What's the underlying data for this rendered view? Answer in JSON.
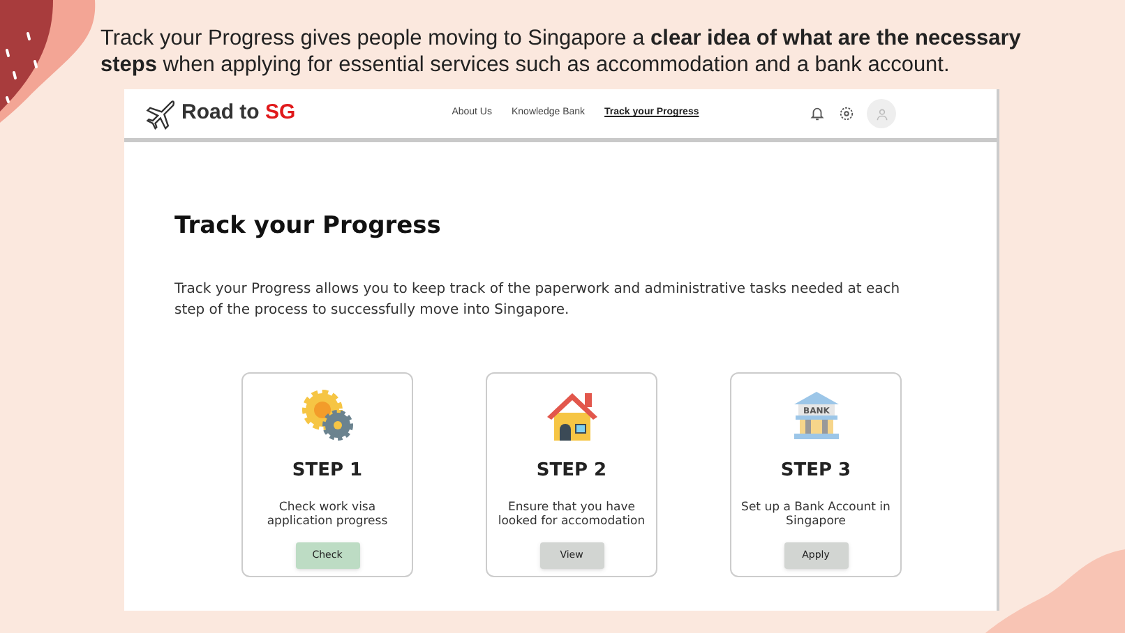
{
  "caption": "Track your Progress gives people moving to Singapore a **clear idea of what are the necessary steps** when applying for essential services such as accommodation and a bank account.",
  "header": {
    "logo_text": "Road to ",
    "logo_accent": "SG",
    "nav": [
      {
        "label": "About Us",
        "selected": false
      },
      {
        "label": "Knowledge Bank",
        "selected": false
      },
      {
        "label": "Track your Progress",
        "selected": true
      }
    ]
  },
  "page": {
    "title": "Track your Progress",
    "description": "Track your Progress allows you to keep track of the paperwork and administrative tasks needed at each step of the process to successfully move into Singapore."
  },
  "steps": [
    {
      "kind": "gears",
      "title": "STEP 1",
      "text": "Check work visa application progress",
      "button": {
        "label": "Check",
        "color": "#bddcc4"
      }
    },
    {
      "kind": "house",
      "title": "STEP 2",
      "text": "Ensure that you have looked for accomodation",
      "button": {
        "label": "View",
        "color": "#d2d5d2"
      }
    },
    {
      "kind": "bank",
      "icon_text": "BANK",
      "title": "STEP 3",
      "text": "Set up a Bank Account in Singapore",
      "button": {
        "label": "Apply",
        "color": "#d2d5d2"
      }
    }
  ]
}
